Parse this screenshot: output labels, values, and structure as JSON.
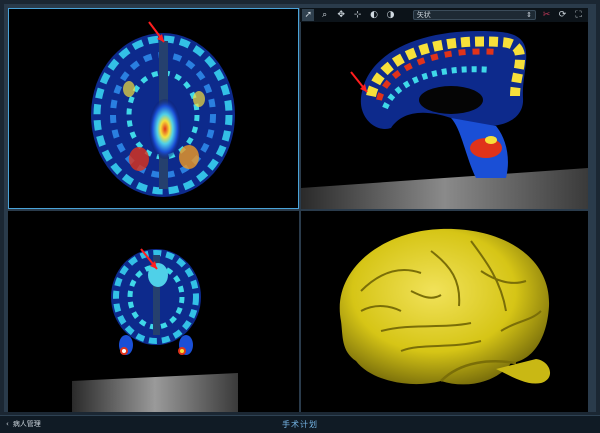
{
  "toolbar": {
    "view_selector_value": "矢状",
    "tools": [
      "pointer-tool",
      "zoom-tool",
      "pan-tool",
      "crosshair-tool",
      "window-level-tool",
      "contrast-tool"
    ]
  },
  "colors": {
    "active_border": "#4aa3d9",
    "accent_text": "#76b6e6",
    "background": "#1b2733",
    "brain_render": "#d6c516"
  },
  "statusbar": {
    "back_label": "病人管理",
    "title": "手术计划"
  }
}
